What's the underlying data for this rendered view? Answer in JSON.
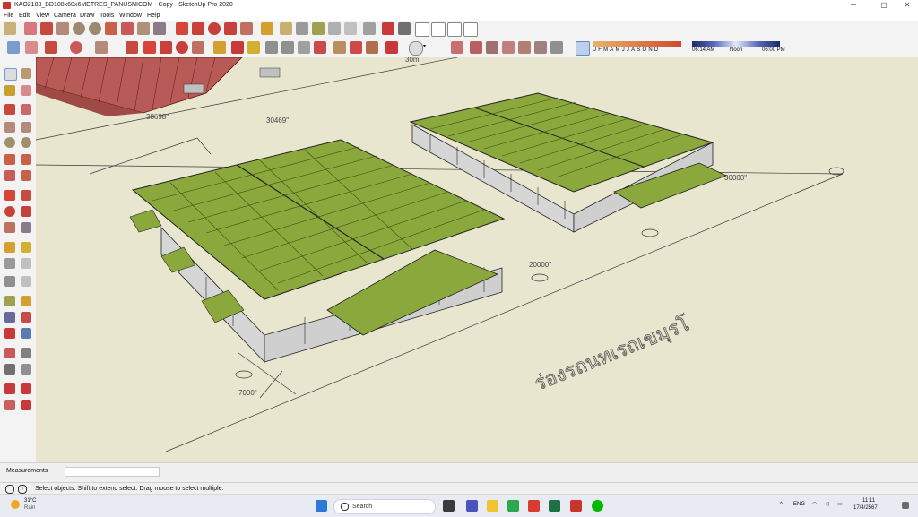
{
  "window": {
    "title": "KAO2188_BD108x60x6METRES_PANUSNICOM - Copy - SketchUp Pro 2020",
    "minimize": "─",
    "maximize": "▢",
    "close": "✕"
  },
  "menu": [
    "File",
    "Edit",
    "View",
    "Camera",
    "Draw",
    "Tools",
    "Window",
    "Help"
  ],
  "shadows": {
    "months": [
      "J",
      "F",
      "M",
      "A",
      "M",
      "J",
      "J",
      "A",
      "S",
      "O",
      "N",
      "D"
    ],
    "time_start": "06:14 AM",
    "time_mid": "Noon",
    "time_end": "06:00 PM"
  },
  "viewport": {
    "dims": [
      "30m",
      "38698\"",
      "30469\"",
      "30000\"",
      "20000\"",
      "7000\""
    ],
    "thai_text": "ร่องรถนทเรถเขมุรโ",
    "colors": {
      "roof": "#8aa83c",
      "roof_dark": "#5f7a22",
      "frame": "#222",
      "ground": "#e9e6cf",
      "red_building": "#b85a55"
    }
  },
  "measurements": {
    "label": "Measurements",
    "value": ""
  },
  "status": {
    "text": "Select objects. Shift to extend select. Drag mouse to select multiple."
  },
  "taskbar": {
    "weather_temp": "31°C",
    "weather_desc": "Rain",
    "search_placeholder": "Search",
    "lang": "ENG",
    "time": "11:11",
    "date": "17/4/2567"
  }
}
